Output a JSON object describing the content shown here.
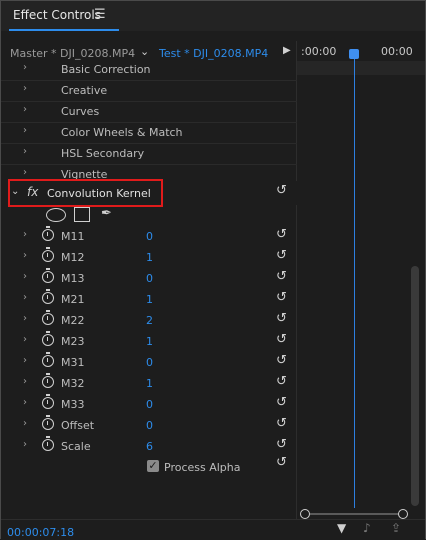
{
  "panel": {
    "title": "Effect Controls",
    "menu_icon": "☰",
    "master_clip": "Master * DJI_0208.MP4",
    "active_clip": "Test * DJI_0208.MP4",
    "chevron": "⌄",
    "play": "▶",
    "timeline_start": ":00:00",
    "timeline_end": "00:00"
  },
  "sections": [
    {
      "label": "Basic Correction"
    },
    {
      "label": "Creative"
    },
    {
      "label": "Curves"
    },
    {
      "label": "Color Wheels & Match"
    },
    {
      "label": "HSL Secondary"
    },
    {
      "label": "Vignette"
    }
  ],
  "effect": {
    "fx_glyph": "fx",
    "name": "Convolution Kernel",
    "expand": "⌄"
  },
  "params": [
    {
      "label": "M11",
      "value": "0"
    },
    {
      "label": "M12",
      "value": "1"
    },
    {
      "label": "M13",
      "value": "0"
    },
    {
      "label": "M21",
      "value": "1"
    },
    {
      "label": "M22",
      "value": "2"
    },
    {
      "label": "M23",
      "value": "1"
    },
    {
      "label": "M31",
      "value": "0"
    },
    {
      "label": "M32",
      "value": "1"
    },
    {
      "label": "M33",
      "value": "0"
    },
    {
      "label": "Offset",
      "value": "0"
    },
    {
      "label": "Scale",
      "value": "6"
    }
  ],
  "process_alpha": {
    "label": "Process Alpha",
    "checked": true,
    "check_glyph": "✓"
  },
  "glyphs": {
    "chevron_right": "›",
    "reset": "↺",
    "pen": "✒",
    "filter": "▼",
    "audio": "♪",
    "export": "⇪"
  },
  "footer": {
    "timecode": "00:00:07:18"
  },
  "colors": {
    "accent": "#2d8ceb",
    "highlight": "#e01b1b",
    "background": "#1d1d1d"
  }
}
